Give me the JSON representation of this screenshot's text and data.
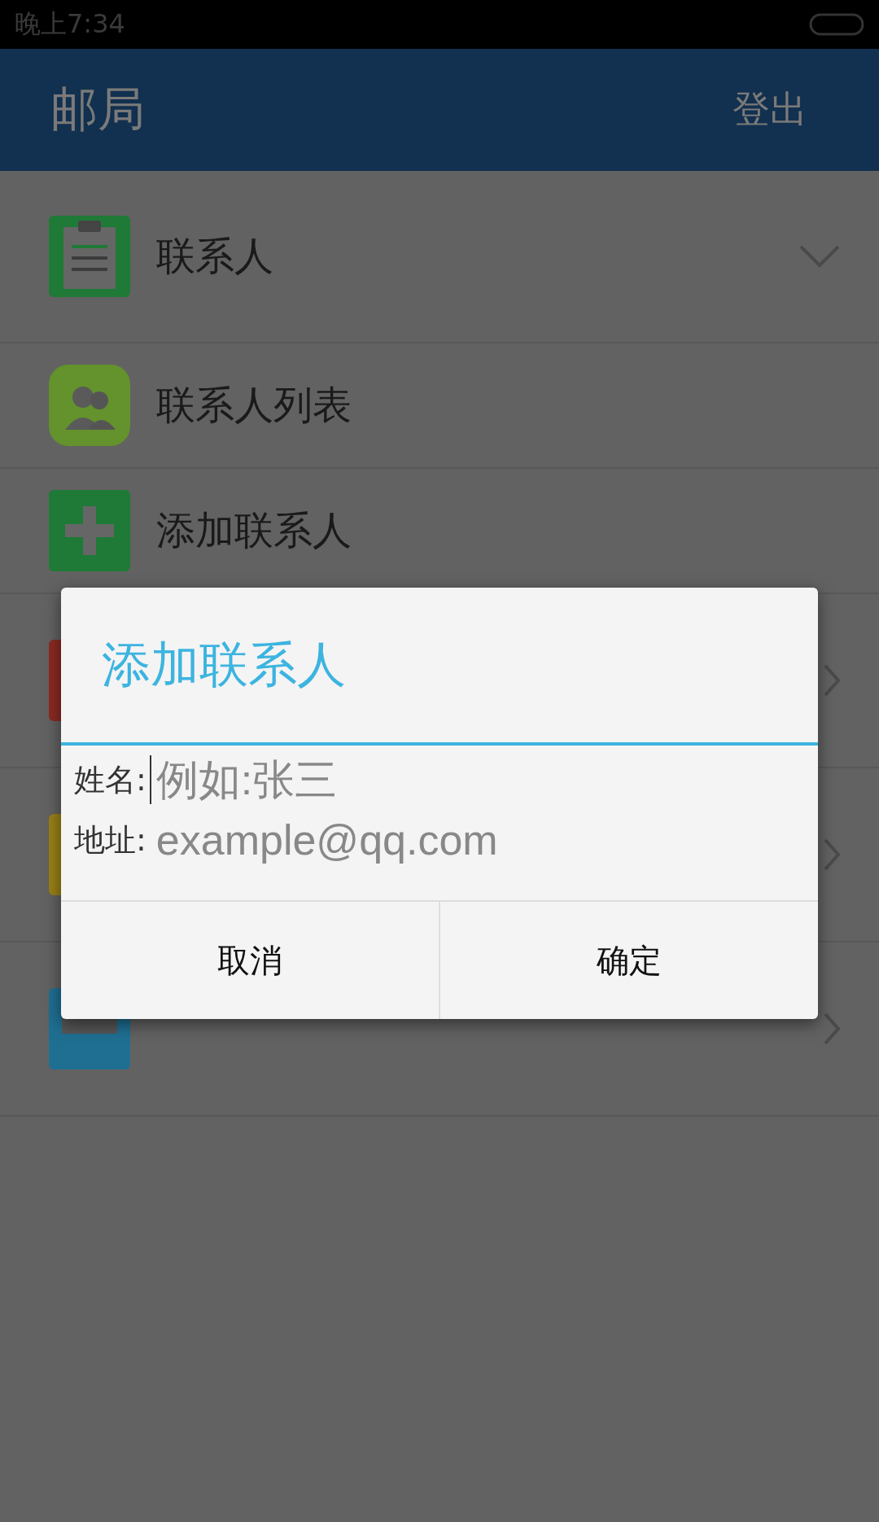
{
  "status_bar": {
    "time": "晚上7:34"
  },
  "app_bar": {
    "title": "邮局",
    "action": "登出"
  },
  "groups": [
    {
      "label": "联系人",
      "color": "#1e7a36",
      "expanded": true,
      "children": [
        {
          "label": "联系人列表",
          "color": "#64922c"
        },
        {
          "label": "添加联系人",
          "color": "#1e7a36"
        }
      ]
    },
    {
      "color": "#8a2a22",
      "expanded": false
    },
    {
      "color": "#9a8016",
      "expanded": false
    },
    {
      "color": "#1f6f92",
      "expanded": false
    }
  ],
  "dialog": {
    "title": "添加联系人",
    "fields": [
      {
        "label": "姓名:",
        "placeholder": "例如:张三",
        "focused": true
      },
      {
        "label": "地址:",
        "placeholder": "example@qq.com",
        "focused": false
      }
    ],
    "buttons": [
      "取消",
      "确定"
    ]
  }
}
